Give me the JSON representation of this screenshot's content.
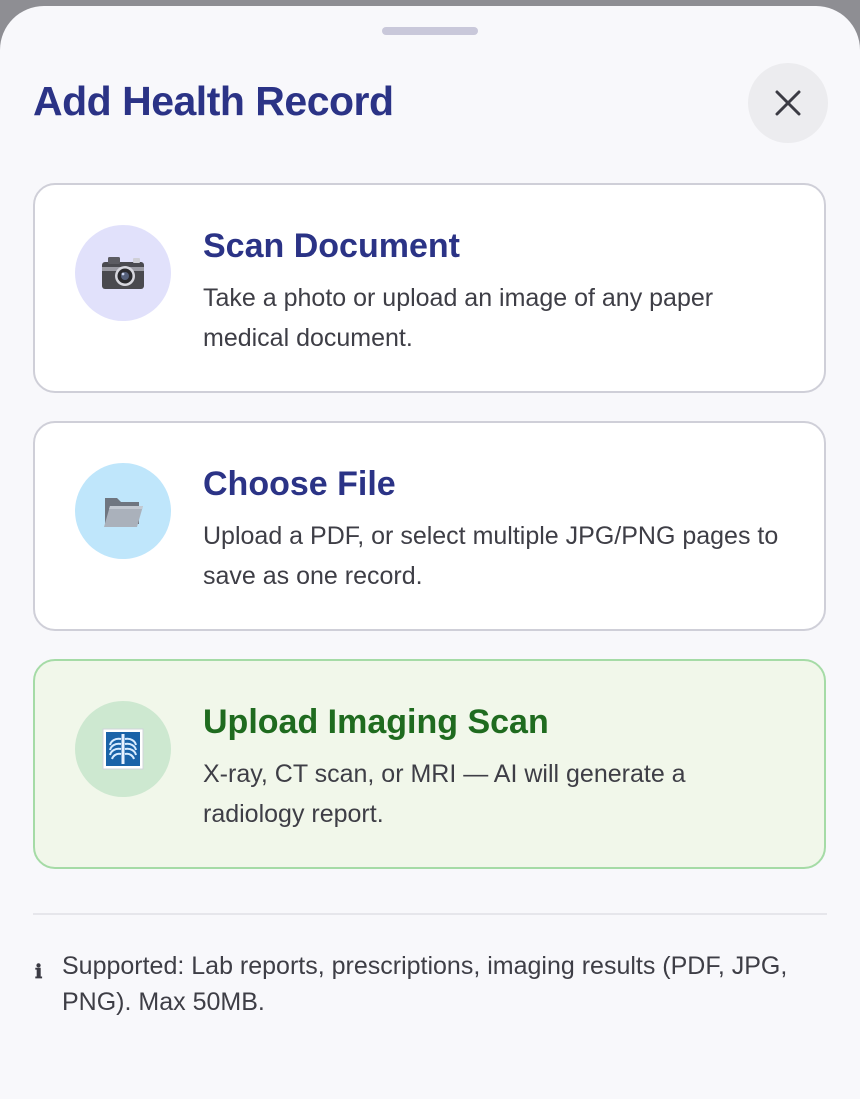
{
  "sheet": {
    "title": "Add Health Record",
    "close_icon": "close-icon"
  },
  "options": [
    {
      "title": "Scan Document",
      "description": "Take a photo or upload an image of any paper medical document.",
      "icon": "camera-icon",
      "icon_bg": "#e1e1fb"
    },
    {
      "title": "Choose File",
      "description": "Upload a PDF, or select multiple JPG/PNG pages to save as one record.",
      "icon": "folder-icon",
      "icon_bg": "#bfe6fb"
    },
    {
      "title": "Upload Imaging Scan",
      "description": "X-ray, CT scan, or MRI — AI will generate a radiology report.",
      "icon": "xray-icon",
      "icon_bg": "#cde8d0",
      "accent": "#1f6b1f"
    }
  ],
  "footer": {
    "info_icon": "ℹ",
    "supported_text": "Supported: Lab reports, prescriptions, imaging results (PDF, JPG, PNG). Max 50MB."
  },
  "colors": {
    "title": "#2b3386",
    "imaging_accent": "#1f6b1f",
    "imaging_bg": "#f1f7ea",
    "imaging_border": "#a5dba6"
  }
}
